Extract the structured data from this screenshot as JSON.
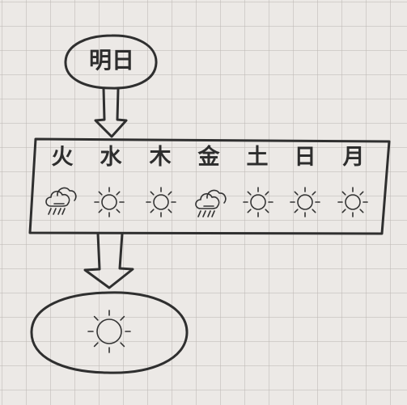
{
  "tomorrow_label": "明日",
  "days": [
    {
      "label": "火",
      "icon": "rain-cloud-icon"
    },
    {
      "label": "水",
      "icon": "sun-icon"
    },
    {
      "label": "木",
      "icon": "sun-icon"
    },
    {
      "label": "金",
      "icon": "rain-cloud-icon"
    },
    {
      "label": "土",
      "icon": "sun-icon"
    },
    {
      "label": "日",
      "icon": "sun-icon"
    },
    {
      "label": "月",
      "icon": "sun-icon"
    }
  ],
  "result_icon": "sun-icon",
  "colors": {
    "ink": "#2f2f2f",
    "background": "#ece9e6",
    "grid": "#bebab4"
  }
}
